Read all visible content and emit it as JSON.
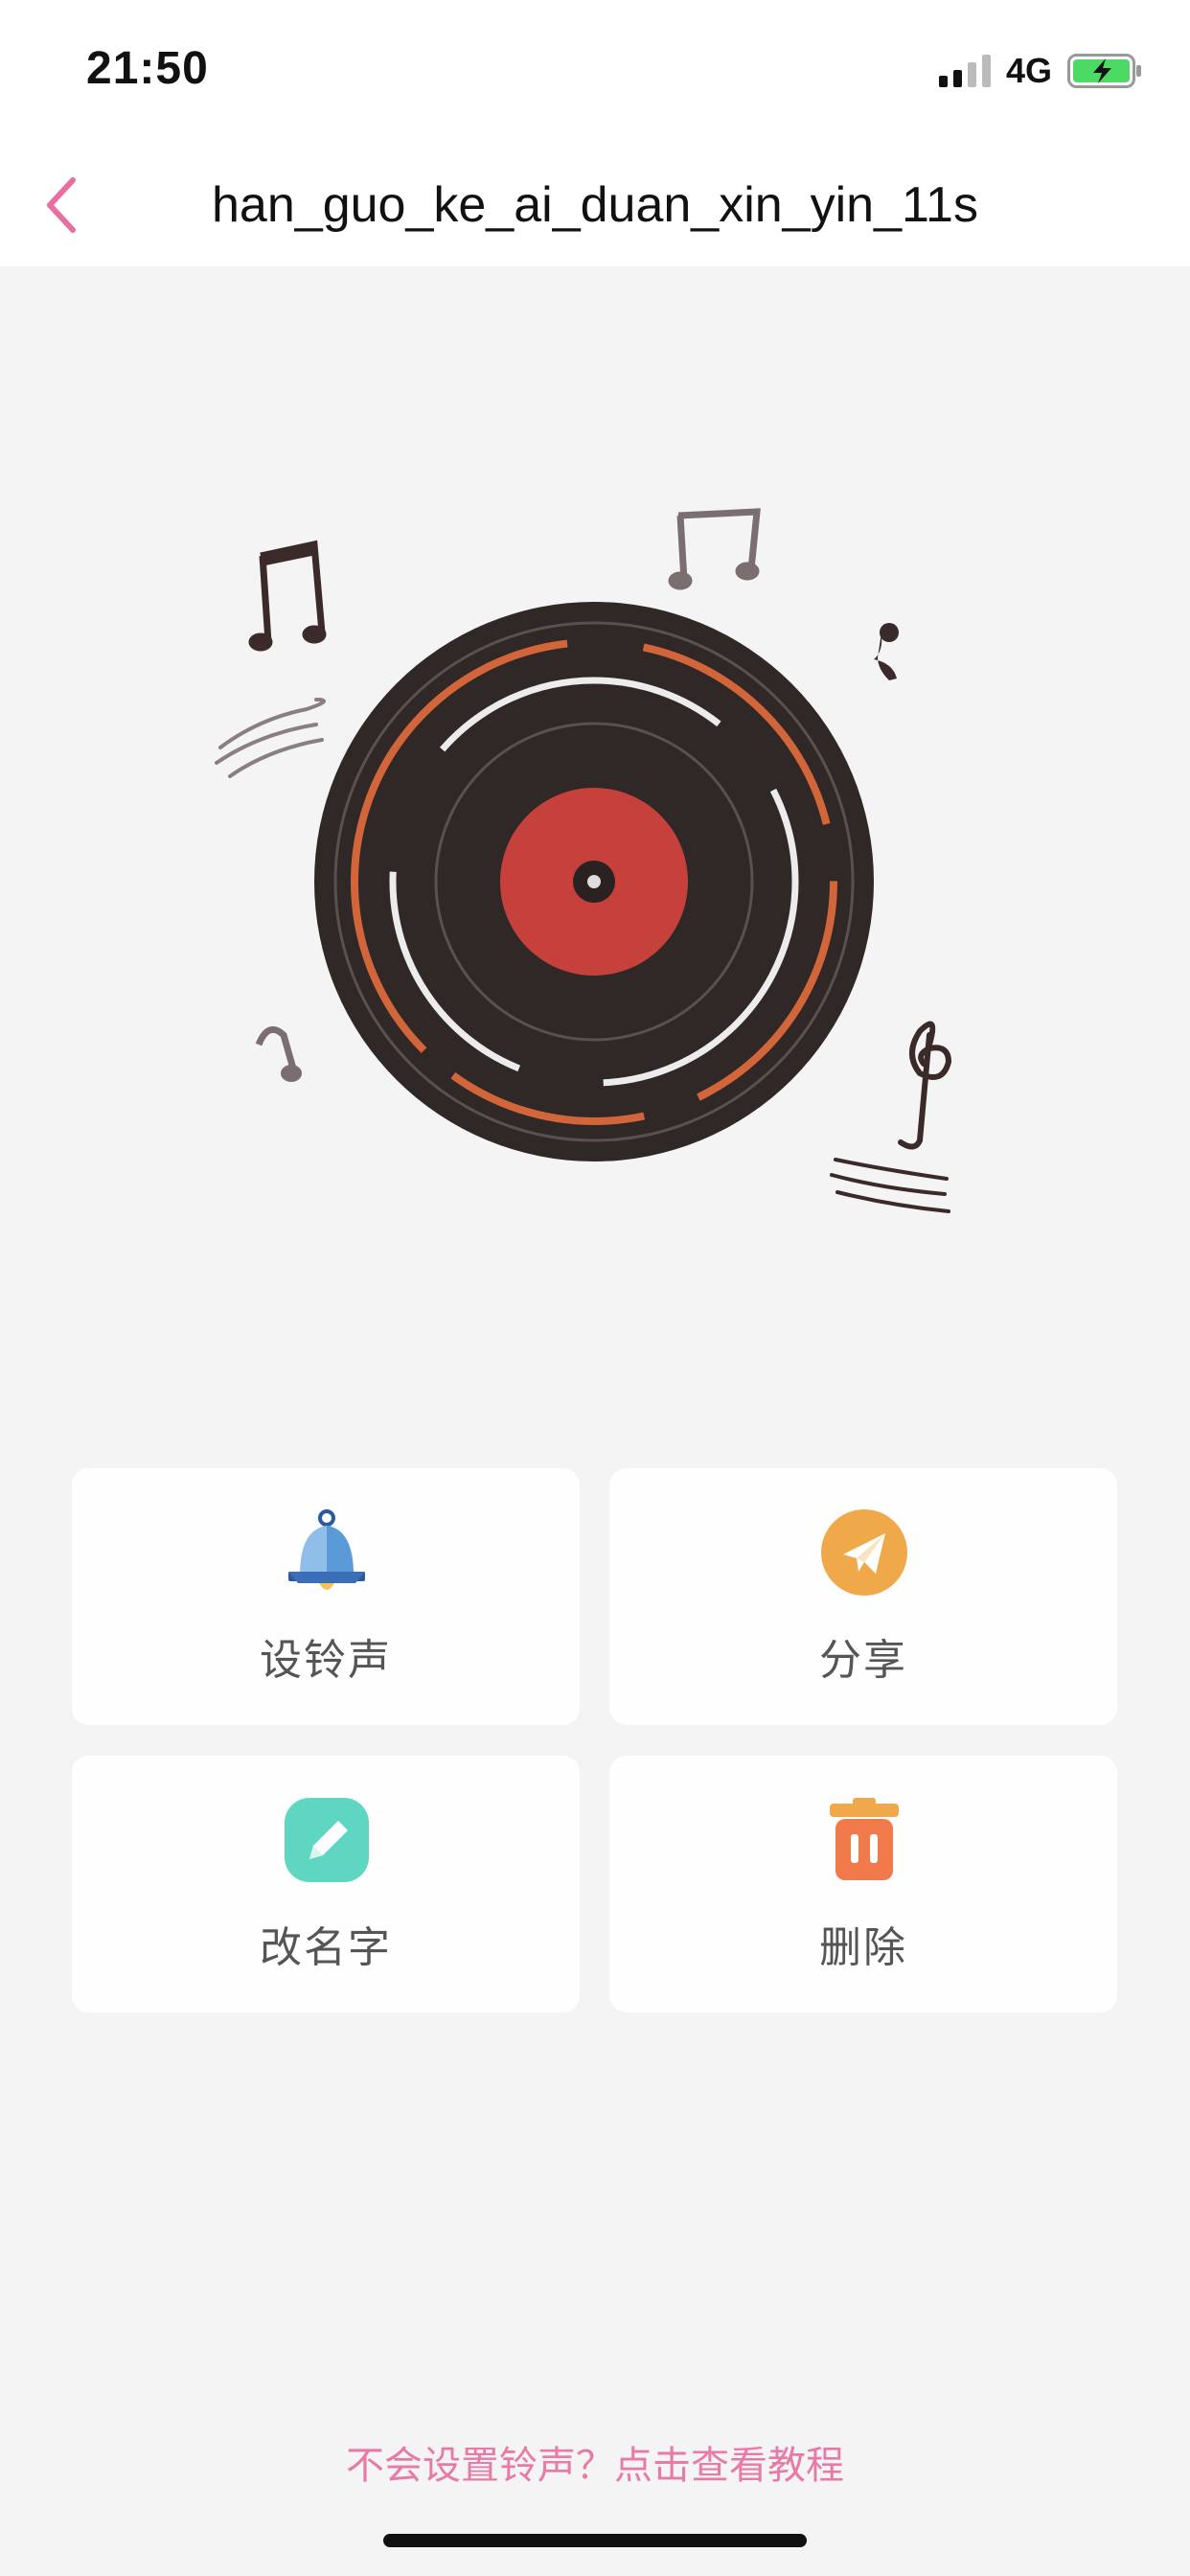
{
  "status_bar": {
    "time": "21:50",
    "network": "4G",
    "battery_color": "#4cd964"
  },
  "nav": {
    "title": "han_guo_ke_ai_duan_xin_yin_11s",
    "back_icon": "chevron-left-icon",
    "accent_color": "#e86fa0"
  },
  "illustration": {
    "icon": "vinyl-record-icon"
  },
  "actions": [
    {
      "label": "设铃声",
      "icon": "bell-icon",
      "color": "#5b9ad8"
    },
    {
      "label": "分享",
      "icon": "paper-plane-icon",
      "color": "#f0a94a"
    },
    {
      "label": "改名字",
      "icon": "pencil-icon",
      "color": "#5fd6c2"
    },
    {
      "label": "删除",
      "icon": "trash-icon",
      "color": "#f07a4a"
    }
  ],
  "footer": {
    "tutorial_link": "不会设置铃声？点击查看教程"
  }
}
